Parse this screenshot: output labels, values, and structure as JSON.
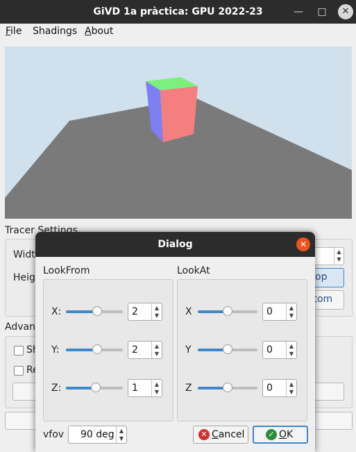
{
  "window": {
    "title": "GiVD 1a pràctica: GPU 2022-23",
    "minimize_icon": "minimize-icon",
    "maximize_icon": "maximize-icon",
    "close_icon": "close-icon"
  },
  "menubar": {
    "items": [
      {
        "label": "File",
        "mnemonic": "F",
        "rest": "ile"
      },
      {
        "label": "Shadings",
        "mnemonic": "",
        "rest": "Shadings"
      },
      {
        "label": "About",
        "mnemonic": "A",
        "rest": "bout"
      }
    ]
  },
  "scene": {
    "background": "#d0e0ec",
    "floor_color": "#7a7a7a",
    "cube_colors": {
      "top": "#7cf07c",
      "front": "#f47f7f",
      "side": "#7f7ff4"
    }
  },
  "background_panel": {
    "tracer_settings_title": "Tracer Settings",
    "width_label_partial": "Widt",
    "height_label_partial": "Heig",
    "top_button_partial": "op",
    "bottom_button_partial": "ttom",
    "advanced_title_partial": "Advan",
    "check1_label_partial": "Sh",
    "check2_label_partial": "Re"
  },
  "dialog": {
    "title": "Dialog",
    "close_icon": "close-icon",
    "lookfrom": {
      "title": "LookFrom",
      "rows": [
        {
          "label": "X:",
          "value": "2",
          "level": 0.55
        },
        {
          "label": "Y:",
          "value": "2",
          "level": 0.55
        },
        {
          "label": "Z:",
          "value": "1",
          "level": 0.52
        }
      ]
    },
    "lookat": {
      "title": "LookAt",
      "rows": [
        {
          "label": "X",
          "value": "0",
          "level": 0.5
        },
        {
          "label": "Y",
          "value": "0",
          "level": 0.5
        },
        {
          "label": "Z",
          "value": "0",
          "level": 0.5
        }
      ]
    },
    "vfov": {
      "label": "vfov",
      "value": "90 deg"
    },
    "cancel": {
      "label": "Cancel",
      "mnemonic": "C",
      "rest": "ancel",
      "icon": "cancel-icon"
    },
    "ok": {
      "label": "OK",
      "mnemonic": "O",
      "rest": "K",
      "icon": "ok-check-icon"
    }
  }
}
